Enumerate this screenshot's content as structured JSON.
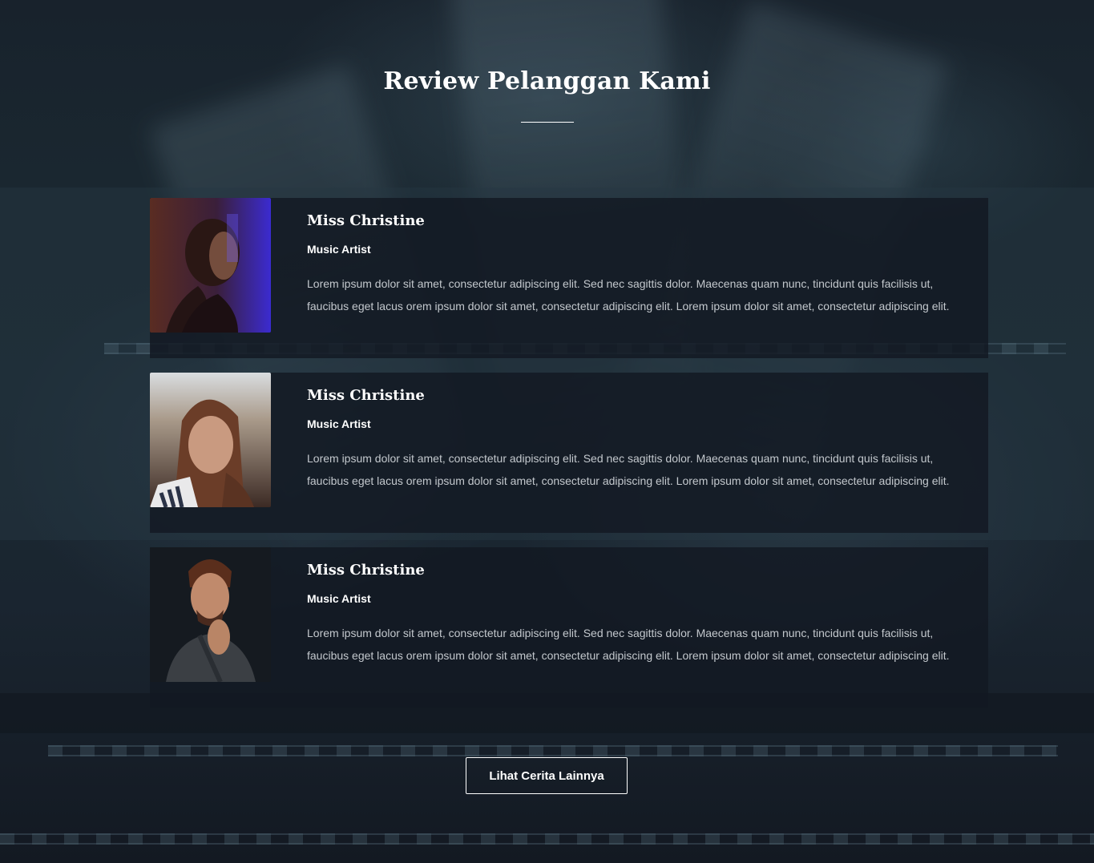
{
  "section": {
    "title": "Review Pelanggan Kami"
  },
  "reviews": [
    {
      "name": "Miss Christine",
      "role": "Music Artist",
      "text": "Lorem ipsum dolor sit amet, consectetur adipiscing elit. Sed nec sagittis dolor. Maecenas quam nunc, tincidunt quis facilisis ut, faucibus eget lacus orem ipsum dolor sit amet, consectetur adipiscing elit. Lorem ipsum dolor sit amet, consectetur adipiscing elit."
    },
    {
      "name": "Miss Christine",
      "role": "Music Artist",
      "text": "Lorem ipsum dolor sit amet, consectetur adipiscing elit. Sed nec sagittis dolor. Maecenas quam nunc, tincidunt quis facilisis ut, faucibus eget lacus orem ipsum dolor sit amet, consectetur adipiscing elit. Lorem ipsum dolor sit amet, consectetur adipiscing elit."
    },
    {
      "name": "Miss Christine",
      "role": "Music Artist",
      "text": "Lorem ipsum dolor sit amet, consectetur adipiscing elit. Sed nec sagittis dolor. Maecenas quam nunc, tincidunt quis facilisis ut, faucibus eget lacus orem ipsum dolor sit amet, consectetur adipiscing elit. Lorem ipsum dolor sit amet, consectetur adipiscing elit."
    }
  ],
  "cta": {
    "label": "Lihat Cerita Lainnya"
  },
  "colors": {
    "background": "#141b24",
    "card": "#121922",
    "text_muted": "#c3c8cd",
    "text": "#ffffff"
  }
}
